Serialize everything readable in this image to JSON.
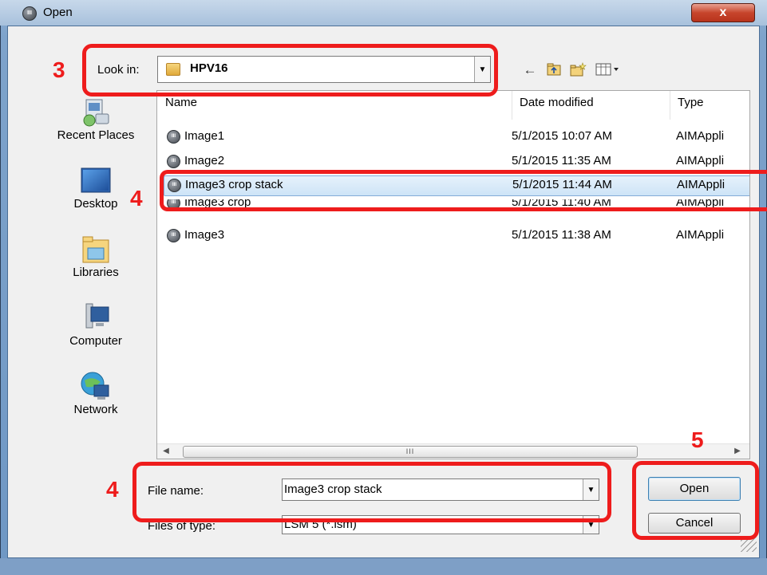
{
  "window": {
    "title": "Open",
    "close_glyph": "x"
  },
  "look_in": {
    "label": "Look in:",
    "value": "HPV16",
    "dropdown_icon": "chevron-down-icon"
  },
  "toolbar": {
    "icons": [
      "back-arrow-icon",
      "up-folder-icon",
      "new-folder-icon",
      "view-menu-icon"
    ]
  },
  "places": [
    {
      "label": "Recent Places",
      "icon": "recent-places-icon"
    },
    {
      "label": "Desktop",
      "icon": "desktop-icon"
    },
    {
      "label": "Libraries",
      "icon": "libraries-icon"
    },
    {
      "label": "Computer",
      "icon": "computer-icon"
    },
    {
      "label": "Network",
      "icon": "network-icon"
    }
  ],
  "file_list": {
    "columns": [
      "Name",
      "Date modified",
      "Type"
    ],
    "rows": [
      {
        "name": "Image1",
        "date": "5/1/2015 10:07 AM",
        "type": "AIMAppli",
        "selected": false
      },
      {
        "name": "Image2",
        "date": "5/1/2015 11:35 AM",
        "type": "AIMAppli",
        "selected": false
      },
      {
        "name": "Image3 crop stack",
        "date": "5/1/2015 11:44 AM",
        "type": "AIMAppli",
        "selected": true
      },
      {
        "name": "Image3 crop",
        "date": "5/1/2015 11:40 AM",
        "type": "AIMAppli",
        "selected": false
      },
      {
        "name": "Image3",
        "date": "5/1/2015 11:38 AM",
        "type": "AIMAppli",
        "selected": false
      }
    ],
    "scroll_thumb_grip": "III"
  },
  "file_name": {
    "label": "File name:",
    "value": "Image3 crop stack"
  },
  "files_of_type": {
    "label": "Files of type:",
    "value": "LSM 5 (*.lsm)"
  },
  "buttons": {
    "open": "Open",
    "cancel": "Cancel"
  },
  "annotations": {
    "step_look_in": "3",
    "step_select_file": "4",
    "step_file_name": "4",
    "step_open": "5",
    "color": "#ee1c1c"
  }
}
